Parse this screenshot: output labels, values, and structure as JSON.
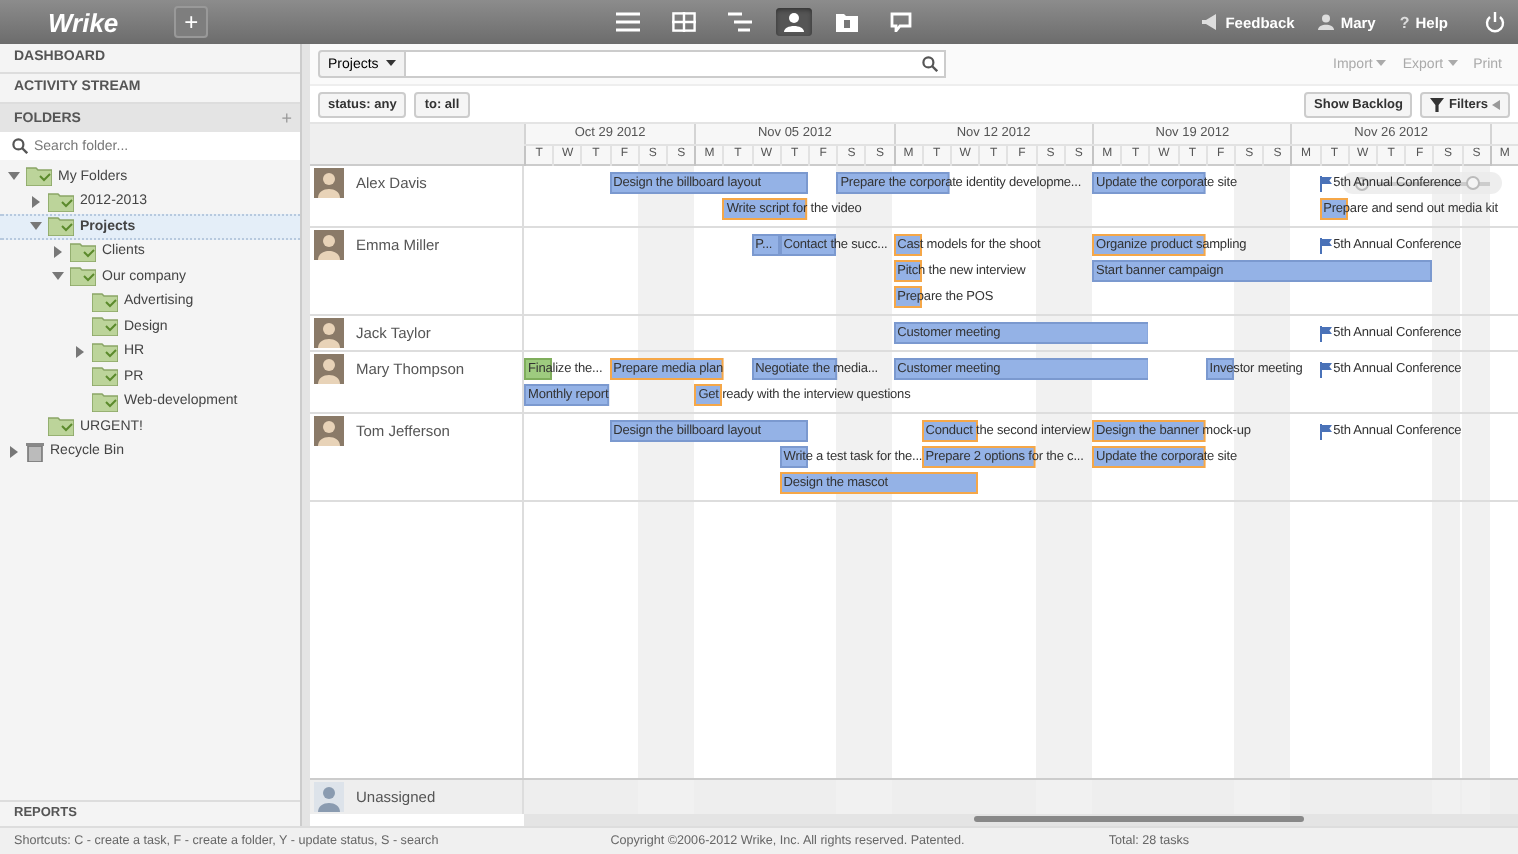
{
  "topbar": {
    "logo": "Wrike",
    "new_button": "+",
    "views": [
      {
        "kind": "list",
        "selected": false
      },
      {
        "kind": "table",
        "selected": false
      },
      {
        "kind": "gantt",
        "selected": false
      },
      {
        "kind": "people",
        "selected": true
      },
      {
        "kind": "reports",
        "selected": false
      },
      {
        "kind": "chat",
        "selected": false
      }
    ],
    "menu": [
      {
        "kind": "feedback",
        "label": "Feedback"
      },
      {
        "kind": "user",
        "label": "Mary"
      },
      {
        "kind": "help",
        "icon": "?",
        "label": "Help"
      },
      {
        "kind": "power"
      }
    ]
  },
  "sidebar": {
    "nav": [
      "DASHBOARD",
      "ACTIVITY STREAM"
    ],
    "folders_header": "FOLDERS",
    "add_button": "+",
    "search": {
      "placeholder": "Search folder..."
    },
    "tree": [
      {
        "label": "My Folders",
        "kind": "folder",
        "selected": false,
        "expanded": true,
        "children": [
          {
            "label": "2012-2013",
            "kind": "folder",
            "selected": false,
            "expanded": false
          },
          {
            "label": "Projects",
            "kind": "folder",
            "selected": true,
            "expanded": true,
            "children": [
              {
                "label": "Clients",
                "kind": "folder",
                "selected": false,
                "expanded": false
              },
              {
                "label": "Our company",
                "kind": "folder",
                "selected": false,
                "expanded": true,
                "children": [
                  {
                    "label": "Advertising",
                    "kind": "folder",
                    "selected": false
                  },
                  {
                    "label": "Design",
                    "kind": "folder",
                    "selected": false
                  },
                  {
                    "label": "HR",
                    "kind": "folder",
                    "selected": false,
                    "expanded": false
                  },
                  {
                    "label": "PR",
                    "kind": "folder",
                    "selected": false
                  },
                  {
                    "label": "Web-development",
                    "kind": "folder",
                    "selected": false
                  }
                ]
              }
            ]
          },
          {
            "label": "URGENT!",
            "kind": "folder",
            "selected": false
          }
        ]
      },
      {
        "label": "Recycle Bin",
        "kind": "bin",
        "selected": false,
        "expanded": false
      }
    ],
    "reports": "REPORTS"
  },
  "toolbar": {
    "scope": "Projects",
    "actions": [
      {
        "label": "Import",
        "dropdown": true,
        "disabled": true
      },
      {
        "label": "Export",
        "dropdown": true,
        "disabled": true
      },
      {
        "label": "Print",
        "dropdown": false,
        "disabled": true
      }
    ]
  },
  "filters": [
    "status: any",
    "to: all"
  ],
  "show_backlog": "Show Backlog",
  "filters_button": "Filters",
  "timeline": {
    "weeks": [
      {
        "label": "Oct 29 2012",
        "days": [
          "T",
          "W",
          "T",
          "F",
          "S",
          "S"
        ]
      },
      {
        "label": "Nov 05 2012",
        "days": [
          "M",
          "T",
          "W",
          "T",
          "F",
          "S",
          "S"
        ]
      },
      {
        "label": "Nov 12 2012",
        "days": [
          "M",
          "T",
          "W",
          "T",
          "F",
          "S",
          "S"
        ]
      },
      {
        "label": "Nov 19 2012",
        "days": [
          "M",
          "T",
          "W",
          "T",
          "F",
          "S",
          "S"
        ]
      },
      {
        "label": "Nov 26 2012",
        "days": [
          "M",
          "T",
          "W",
          "T",
          "F",
          "S",
          "S"
        ]
      },
      {
        "days": [
          "M"
        ]
      }
    ],
    "people": [
      {
        "name": "Alex Davis",
        "lines": [
          [
            {
              "kind": "task",
              "label": "Design the billboard layout",
              "completed": false,
              "overdue": false
            },
            {
              "kind": "task",
              "label": "Prepare the corporate identity developme...",
              "completed": false,
              "overdue": false
            },
            {
              "kind": "task",
              "label": "Update the corporate site",
              "completed": false,
              "overdue": false
            },
            {
              "kind": "milestone",
              "label": "5th Annual Conference"
            }
          ],
          [
            {
              "kind": "task",
              "label": "Write script for the video",
              "completed": false,
              "overdue": true
            },
            {
              "kind": "task",
              "label": "Prepare and send out media kit",
              "completed": false,
              "overdue": true
            }
          ]
        ]
      },
      {
        "name": "Emma Miller",
        "lines": [
          [
            {
              "kind": "task",
              "label": "P...",
              "completed": false,
              "overdue": false
            },
            {
              "kind": "task",
              "label": "Contact the succ...",
              "completed": false,
              "overdue": false
            },
            {
              "kind": "task",
              "label": "Cast models for the shoot",
              "completed": false,
              "overdue": true
            },
            {
              "kind": "task",
              "label": "Organize product sampling",
              "completed": false,
              "overdue": true
            },
            {
              "kind": "milestone",
              "label": "5th Annual Conference"
            }
          ],
          [
            {
              "kind": "task",
              "label": "Pitch the new interview",
              "completed": false,
              "overdue": true
            },
            {
              "kind": "task",
              "label": "Start banner campaign",
              "completed": false,
              "overdue": false
            }
          ],
          [
            {
              "kind": "task",
              "label": "Prepare the POS",
              "completed": false,
              "overdue": true
            }
          ]
        ]
      },
      {
        "name": "Jack Taylor",
        "lines": [
          [
            {
              "kind": "task",
              "label": "Customer meeting",
              "completed": false,
              "overdue": false
            },
            {
              "kind": "milestone",
              "label": "5th Annual Conference"
            }
          ]
        ]
      },
      {
        "name": "Mary Thompson",
        "lines": [
          [
            {
              "kind": "task",
              "label": "Finalize the...",
              "completed": true,
              "overdue": false
            },
            {
              "kind": "task",
              "label": "Prepare media plan",
              "completed": false,
              "overdue": true
            },
            {
              "kind": "task",
              "label": "Negotiate the media...",
              "completed": false,
              "overdue": false
            },
            {
              "kind": "task",
              "label": "Customer meeting",
              "completed": false,
              "overdue": false
            },
            {
              "kind": "task",
              "label": "Investor meeting",
              "completed": false,
              "overdue": false
            },
            {
              "kind": "milestone",
              "label": "5th Annual Conference"
            }
          ],
          [
            {
              "kind": "task",
              "label": "Monthly report",
              "completed": false,
              "overdue": false
            },
            {
              "kind": "task",
              "label": "Get ready with the interview questions",
              "completed": false,
              "overdue": true
            }
          ]
        ]
      },
      {
        "name": "Tom Jefferson",
        "lines": [
          [
            {
              "kind": "task",
              "label": "Design the billboard layout",
              "completed": false,
              "overdue": false
            },
            {
              "kind": "task",
              "label": "Conduct the second interview",
              "completed": false,
              "overdue": true
            },
            {
              "kind": "task",
              "label": "Design the banner mock-up",
              "completed": false,
              "overdue": true
            },
            {
              "kind": "milestone",
              "label": "5th Annual Conference"
            }
          ],
          [
            {
              "kind": "task",
              "label": "Write a test task for the...",
              "completed": false,
              "overdue": false
            },
            {
              "kind": "task",
              "label": "Prepare 2 options for the c...",
              "completed": false,
              "overdue": true
            },
            {
              "kind": "task",
              "label": "Update the corporate site",
              "completed": false,
              "overdue": true
            }
          ],
          [
            {
              "kind": "task",
              "label": "Design the mascot",
              "completed": false,
              "overdue": true
            }
          ]
        ]
      }
    ],
    "unassigned": "Unassigned"
  },
  "zoom_slider": {
    "level": 0.85
  },
  "status_bar": {
    "shortcuts": "Shortcuts: C - create a task, F - create a folder, Y - update status, S - search",
    "copyright": "Copyright ©2006-2012 Wrike, Inc. All rights reserved. Patented.",
    "total": "Total: 28 tasks"
  }
}
